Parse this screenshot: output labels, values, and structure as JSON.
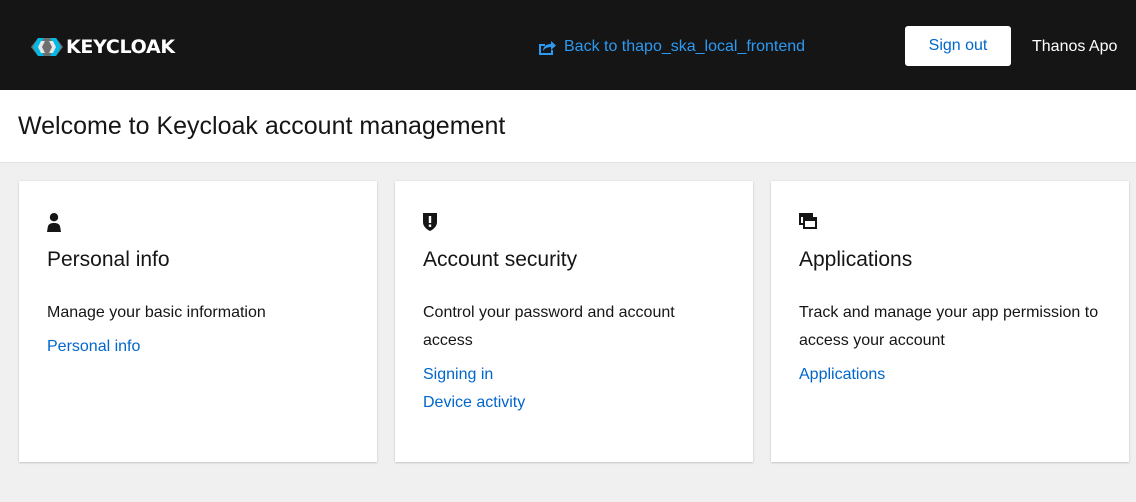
{
  "header": {
    "logo_text": "KEYCLOAK",
    "back_link": "Back to thapo_ska_local_frontend",
    "back_link_icon": "external-share-icon",
    "signout_label": "Sign out",
    "user_name": "Thanos Apo"
  },
  "page": {
    "title": "Welcome to Keycloak account management"
  },
  "cards": [
    {
      "icon": "user-icon",
      "title": "Personal info",
      "description": "Manage your basic information",
      "links": [
        "Personal info"
      ]
    },
    {
      "icon": "shield-icon",
      "title": "Account security",
      "description": "Control your password and account access",
      "links": [
        "Signing in",
        "Device activity"
      ]
    },
    {
      "icon": "applications-icon",
      "title": "Applications",
      "description": "Track and manage your app permission to access your account",
      "links": [
        "Applications"
      ]
    }
  ],
  "colors": {
    "header_bg": "#151515",
    "link": "#0066cc",
    "header_link": "#2b9af3",
    "page_bg": "#f0f0f0"
  }
}
